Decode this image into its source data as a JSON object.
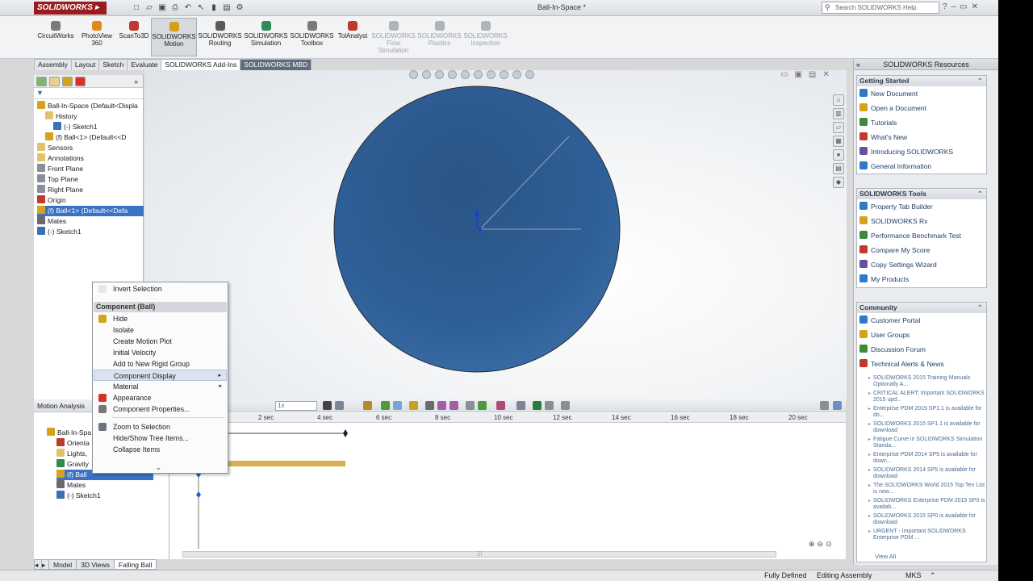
{
  "app": {
    "logo_text": "SOLIDWORKS",
    "document_title": "Ball-In-Space *",
    "help_search_placeholder": "Search SOLIDWORKS Help"
  },
  "ribbon": {
    "buttons": [
      {
        "label": "CircuitWorks",
        "color": "#7a7a7a"
      },
      {
        "label": "PhotoView 360",
        "color": "#e08a1e"
      },
      {
        "label": "ScanTo3D",
        "color": "#c0392b"
      },
      {
        "label": "SOLIDWORKS Motion",
        "color": "#d4a017",
        "active": true
      },
      {
        "label": "SOLIDWORKS Routing",
        "color": "#5a5a5a"
      },
      {
        "label": "SOLIDWORKS Simulation",
        "color": "#2e8b57"
      },
      {
        "label": "SOLIDWORKS Toolbox",
        "color": "#7a7a7a"
      },
      {
        "label": "TolAnalyst",
        "color": "#c0392b"
      },
      {
        "label": "SOLIDWORKS Flow Simulation",
        "color": "#b0b4ba",
        "disabled": true
      },
      {
        "label": "SOLIDWORKS Plastics",
        "color": "#b0b4ba",
        "disabled": true
      },
      {
        "label": "SOLIDWORKS Inspection",
        "color": "#b0b4ba",
        "disabled": true
      }
    ]
  },
  "command_tabs": [
    "Assembly",
    "Layout",
    "Sketch",
    "Evaluate",
    "SOLIDWORKS Add-Ins",
    "SOLIDWORKS MBD"
  ],
  "feature_tree": {
    "items": [
      {
        "label": "Ball-In-Space  (Default<Displa",
        "icon": "assembly-icon",
        "color": "#d6a21c"
      },
      {
        "label": "History",
        "icon": "history-icon",
        "color": "#e2c36a"
      },
      {
        "label": "(-) Sketch1",
        "icon": "sketch-icon",
        "color": "#3b6fb8"
      },
      {
        "label": "(f) Ball<1> (Default<<D",
        "icon": "part-icon",
        "color": "#d6a21c"
      },
      {
        "label": "Sensors",
        "icon": "sensor-icon",
        "color": "#e2c36a"
      },
      {
        "label": "Annotations",
        "icon": "annotation-icon",
        "color": "#e2c36a"
      },
      {
        "label": "Front Plane",
        "icon": "plane-icon",
        "color": "#8a9099"
      },
      {
        "label": "Top Plane",
        "icon": "plane-icon",
        "color": "#8a9099"
      },
      {
        "label": "Right Plane",
        "icon": "plane-icon",
        "color": "#8a9099"
      },
      {
        "label": "Origin",
        "icon": "origin-icon",
        "color": "#c0392b"
      },
      {
        "label": "(f) Ball<1> (Default<<Defa",
        "icon": "part-icon",
        "color": "#d6a21c",
        "selected": true
      },
      {
        "label": "Mates",
        "icon": "mates-icon",
        "color": "#6a6a6a"
      },
      {
        "label": "(-) Sketch1",
        "icon": "sketch-icon",
        "color": "#3b6fb8"
      }
    ]
  },
  "context_menu": {
    "top_item": "Invert Selection",
    "header": "Component (Ball)",
    "items": [
      {
        "label": "Hide",
        "icon": "glasses-icon",
        "color": "#d6a21c"
      },
      {
        "label": "Isolate"
      },
      {
        "label": "Create Motion Plot"
      },
      {
        "label": "Initial Velocity"
      },
      {
        "label": "Add to New Rigid Group"
      },
      {
        "label": "Component Display",
        "submenu": true,
        "hover": true
      },
      {
        "label": "Material",
        "submenu": true
      },
      {
        "label": "Appearance",
        "icon": "appearance-icon",
        "color": "#d9302c"
      },
      {
        "label": "Component Properties...",
        "icon": "properties-icon",
        "color": "#777777"
      },
      {
        "label": "Zoom to Selection",
        "icon": "zoom-icon",
        "color": "#6c7480"
      },
      {
        "label": "Hide/Show Tree Items..."
      },
      {
        "label": "Collapse Items"
      }
    ],
    "more": "⌄"
  },
  "resources_panel": {
    "title": "SOLIDWORKS Resources",
    "getting_started": {
      "title": "Getting Started",
      "items": [
        "New Document",
        "Open a Document",
        "Tutorials",
        "What's New",
        "Introducing SOLIDWORKS",
        "General Information"
      ]
    },
    "tools": {
      "title": "SOLIDWORKS Tools",
      "items": [
        "Property Tab Builder",
        "SOLIDWORKS Rx",
        "Performance Benchmark Test",
        "Compare My Score",
        "Copy Settings Wizard",
        "My Products"
      ]
    },
    "community": {
      "title": "Community",
      "items": [
        "Customer Portal",
        "User Groups",
        "Discussion Forum",
        "Technical Alerts & News"
      ],
      "news": [
        "SOLIDWORKS 2015 Training Manuals Optionally A...",
        "CRITICAL ALERT: Important SOLIDWORKS 2015 upd...",
        "Enterprise PDM 2015 SP1.1 is available for do...",
        "SOLIDWORKS 2015 SP1.1 is available for download",
        "Fatigue Curve in SOLIDWORKS Simulation Standa...",
        "Enterprise PDM 2014 SP5 is available for down...",
        "SOLIDWORKS 2014 SP5 is available for download",
        "The SOLIDWORKS World 2015 Top Ten List is now...",
        "SOLIDWORKS Enterprise PDM 2015 SP0 is availab...",
        "SOLIDWORKS 2015 SP0 is available for download",
        "URGENT - Important SOLIDWORKS Enterprise PDM ..."
      ],
      "view_all": "View All"
    }
  },
  "motion": {
    "study_type": "Motion Analysis",
    "tree": [
      {
        "label": "Ball-In-Spa",
        "icon": "assembly-icon",
        "color": "#d6a21c"
      },
      {
        "label": "Orienta",
        "icon": "orientation-icon",
        "color": "#c0392b"
      },
      {
        "label": "Lights,",
        "icon": "lights-icon",
        "color": "#e2c36a"
      },
      {
        "label": "Gravity",
        "icon": "gravity-icon",
        "color": "#2e8b57"
      },
      {
        "label": "(f) Ball",
        "icon": "part-icon",
        "color": "#d6a21c",
        "selected": true
      },
      {
        "label": "Mates",
        "icon": "mates-icon",
        "color": "#6a6a6a"
      },
      {
        "label": "(-) Sketch1",
        "icon": "sketch-icon",
        "color": "#3b6fb8"
      }
    ],
    "time_labels": [
      "2 sec",
      "4 sec",
      "6 sec",
      "8 sec",
      "10 sec",
      "12 sec",
      "14 sec",
      "16 sec",
      "18 sec",
      "20 sec"
    ]
  },
  "bottom_tabs": [
    "Model",
    "3D Views",
    "Falling Ball"
  ],
  "status": {
    "defined": "Fully Defined",
    "mode": "Editing Assembly",
    "units": "MKS"
  },
  "colors": {
    "ball": "#2f5f98",
    "accent": "#3a73c4"
  }
}
